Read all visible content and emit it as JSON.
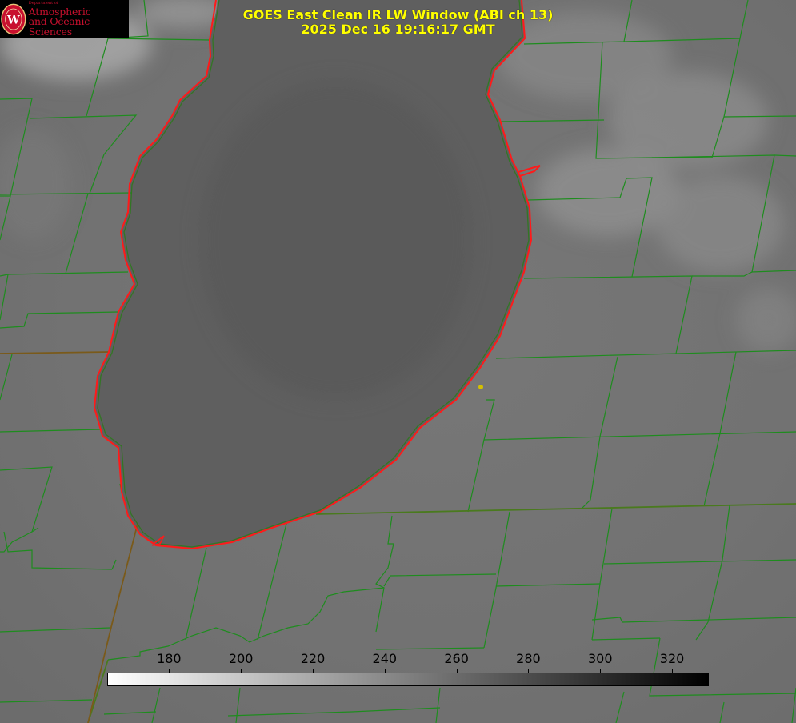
{
  "logo": {
    "department": "Department of",
    "line1": "Atmospheric",
    "line2": "and Oceanic Sciences",
    "crest_letter": "W"
  },
  "title": {
    "line1": "GOES East Clean IR LW Window (ABI ch 13)",
    "line2": "2025 Dec 16 19:16:17 GMT"
  },
  "colorbar": {
    "min": 163,
    "max": 330,
    "ticks": [
      "180",
      "200",
      "220",
      "240",
      "260",
      "280",
      "300",
      "320"
    ],
    "gradient_start": "#ffffff",
    "gradient_end": "#000000"
  },
  "colors": {
    "county_lines": "#1e8c1e",
    "coastline": "#ff1a1a",
    "city_marker": "#d4c000",
    "title_text": "#ffff00",
    "logo_text": "#c8102e"
  }
}
